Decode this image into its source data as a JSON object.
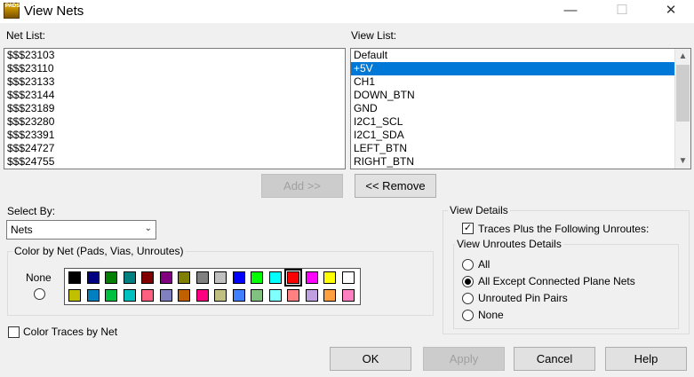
{
  "window": {
    "title": "View Nets",
    "app_icon_text": "PADS",
    "minimize": "—",
    "maximize": "☐",
    "close": "✕"
  },
  "net_list": {
    "label": "Net List:",
    "items": [
      "$$$23103",
      "$$$23110",
      "$$$23133",
      "$$$23144",
      "$$$23189",
      "$$$23280",
      "$$$23391",
      "$$$24727",
      "$$$24755"
    ]
  },
  "view_list": {
    "label": "View List:",
    "items": [
      "Default",
      "+5V",
      "CH1",
      "DOWN_BTN",
      "GND",
      "I2C1_SCL",
      "I2C1_SDA",
      "LEFT_BTN",
      "RIGHT_BTN"
    ],
    "selected_index": 1
  },
  "transfer": {
    "add_label": "Add >>",
    "remove_label": "<< Remove"
  },
  "select_by": {
    "label": "Select By:",
    "value": "Nets"
  },
  "color_group": {
    "title": "Color by Net (Pads, Vias, Unroutes)",
    "none_label": "None",
    "selected_color": "#ff0000",
    "row1": [
      "#000000",
      "#000080",
      "#008000",
      "#008080",
      "#800000",
      "#800080",
      "#808000",
      "#808080",
      "#c0c0c0",
      "#0000ff",
      "#00ff00",
      "#00ffff",
      "#ff0000",
      "#ff00ff",
      "#ffff00",
      "#ffffff"
    ],
    "row2": [
      "#c0c000",
      "#0080c0",
      "#00c040",
      "#00c0c0",
      "#ff6080",
      "#8080c0",
      "#c06000",
      "#ff0080",
      "#c0c080",
      "#4080ff",
      "#80c080",
      "#80ffff",
      "#ff8080",
      "#c0a0e0",
      "#ffa040",
      "#ff80c0"
    ]
  },
  "color_traces": {
    "label": "Color Traces by Net",
    "checked": false
  },
  "view_details": {
    "title": "View Details",
    "traces_label": "Traces Plus the Following Unroutes:",
    "traces_checked": true,
    "unroutes_title": "View Unroutes Details",
    "options": [
      "All",
      "All Except Connected Plane Nets",
      "Unrouted Pin Pairs",
      "None"
    ],
    "selected_option": 1
  },
  "footer": {
    "ok": "OK",
    "apply": "Apply",
    "cancel": "Cancel",
    "help": "Help"
  }
}
